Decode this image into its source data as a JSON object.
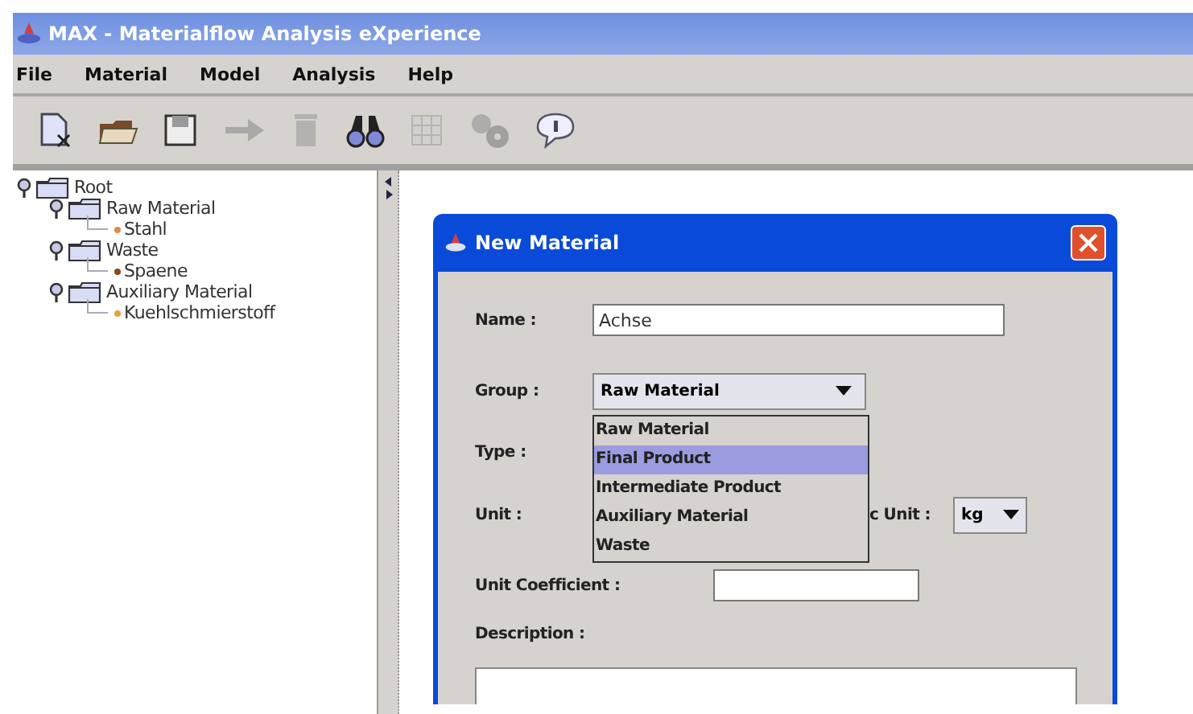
{
  "window": {
    "title": "MAX - Materialflow Analysis eXperience"
  },
  "menu": [
    {
      "label": "File"
    },
    {
      "label": "Material"
    },
    {
      "label": "Model"
    },
    {
      "label": "Analysis"
    },
    {
      "label": "Help"
    }
  ],
  "toolbar": [
    {
      "kind": "new",
      "disabled": false
    },
    {
      "kind": "open",
      "disabled": false
    },
    {
      "kind": "save",
      "disabled": false
    },
    {
      "kind": "arrow",
      "disabled": true
    },
    {
      "kind": "trash",
      "disabled": true
    },
    {
      "kind": "find",
      "disabled": false
    },
    {
      "kind": "grid",
      "disabled": true
    },
    {
      "kind": "gears",
      "disabled": true
    },
    {
      "kind": "info",
      "disabled": false
    }
  ],
  "tree": [
    {
      "label": "Root",
      "expanded": true,
      "children": [
        {
          "label": "Raw Material",
          "expanded": true,
          "children": [
            {
              "label": "Stahl",
              "color": "#e08a4a"
            }
          ]
        },
        {
          "label": "Waste",
          "expanded": true,
          "children": [
            {
              "label": "Spaene",
              "color": "#8a4a1a"
            }
          ]
        },
        {
          "label": "Auxiliary Material",
          "expanded": true,
          "children": [
            {
              "label": "Kuehlschmierstoff",
              "color": "#e8a040"
            }
          ]
        }
      ]
    }
  ],
  "dialog": {
    "title": "New Material",
    "name": {
      "label": "Name :",
      "value": "Achse"
    },
    "group": {
      "label": "Group :",
      "value": "Raw Material",
      "options": [
        {
          "label": "Raw Material",
          "highlighted": false
        },
        {
          "label": "Final Product",
          "highlighted": true
        },
        {
          "label": "Intermediate Product",
          "highlighted": false
        },
        {
          "label": "Auxiliary Material",
          "highlighted": false
        },
        {
          "label": "Waste",
          "highlighted": false
        }
      ]
    },
    "type": {
      "label": "Type :"
    },
    "unit": {
      "label": "Unit :"
    },
    "basic_unit": {
      "label": "c Unit :",
      "value": "kg"
    },
    "unit_coefficient": {
      "label": "Unit Coefficient :"
    },
    "description": {
      "label": "Description :"
    }
  }
}
